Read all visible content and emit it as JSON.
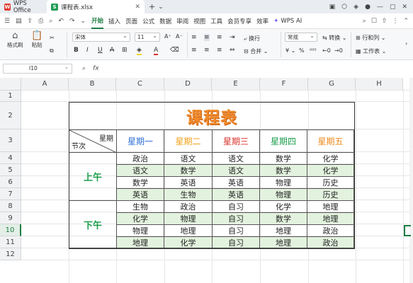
{
  "titlebar": {
    "app_tab": "WPS Office",
    "file_tab": "课程表.xlsx"
  },
  "menubar": {
    "items": [
      "开始",
      "插入",
      "页面",
      "公式",
      "数据",
      "审阅",
      "视图",
      "工具",
      "会员专享",
      "效率"
    ],
    "ai": "WPS AI"
  },
  "ribbon": {
    "format_painter": "格式刷",
    "paste": "粘贴",
    "font_name": "宋体",
    "font_size": "11",
    "wrap": "换行",
    "merge": "合并",
    "number_format": "常规",
    "convert": "转换",
    "rows_cols": "行和列",
    "worksheet": "工作表"
  },
  "formula_bar": {
    "name_box": "I10",
    "fx": "fx"
  },
  "columns": [
    "A",
    "B",
    "C",
    "D",
    "E",
    "F",
    "G",
    "H"
  ],
  "rows": [
    "1",
    "2",
    "3",
    "4",
    "5",
    "6",
    "7",
    "8",
    "9",
    "10",
    "11",
    "12"
  ],
  "schedule": {
    "title": "课程表",
    "corner_top": "星期",
    "corner_bottom": "节次",
    "days": [
      {
        "label": "星期一",
        "color": "#2f6fd6"
      },
      {
        "label": "星期二",
        "color": "#f0a21a"
      },
      {
        "label": "星期三",
        "color": "#d9312b"
      },
      {
        "label": "星期四",
        "color": "#1b9e4b"
      },
      {
        "label": "星期五",
        "color": "#ef8a1c"
      }
    ],
    "morning": "上午",
    "afternoon": "下午",
    "lessons": [
      [
        "政治",
        "语文",
        "语文",
        "数学",
        "化学"
      ],
      [
        "语文",
        "数学",
        "语文",
        "数学",
        "化学"
      ],
      [
        "数学",
        "英语",
        "英语",
        "物理",
        "历史"
      ],
      [
        "英语",
        "生物",
        "英语",
        "物理",
        "历史"
      ],
      [
        "生物",
        "政治",
        "自习",
        "化学",
        "地理"
      ],
      [
        "化学",
        "物理",
        "自习",
        "数学",
        "地理"
      ],
      [
        "物理",
        "地理",
        "自习",
        "地理",
        "政治"
      ],
      [
        "地理",
        "化学",
        "自习",
        "地理",
        "政治"
      ]
    ]
  }
}
